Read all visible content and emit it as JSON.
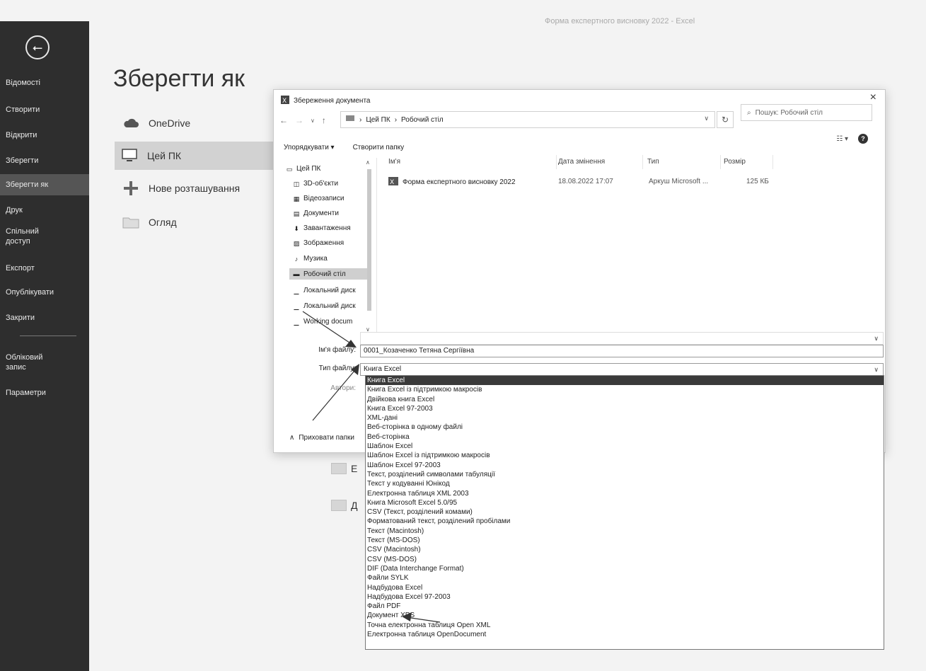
{
  "window_title": "Форма експертного висновку 2022 - Excel",
  "backstage": {
    "back_label": "⭠",
    "items": [
      {
        "label": "Відомості"
      },
      {
        "label": "Створити"
      },
      {
        "label": "Відкрити"
      },
      {
        "label": "Зберегти"
      },
      {
        "label": "Зберегти як"
      },
      {
        "label": "Друк"
      },
      {
        "label": "Спільний доступ"
      },
      {
        "label": "Експорт"
      },
      {
        "label": "Опублікувати"
      },
      {
        "label": "Закрити"
      },
      {
        "label": "Обліковий запис"
      },
      {
        "label": "Параметри"
      }
    ]
  },
  "page_title": "Зберегти як",
  "locations": [
    {
      "label": "OneDrive",
      "icon": "cloud-icon"
    },
    {
      "label": "Цей ПК",
      "icon": "computer-icon"
    },
    {
      "label": "Нове розташування",
      "icon": "plus-icon"
    },
    {
      "label": "Огляд",
      "icon": "folder-icon"
    }
  ],
  "recent_folders": [
    {
      "label": "E"
    },
    {
      "label": "Д"
    }
  ],
  "dialog": {
    "title": "Збереження документа",
    "close": "×",
    "path": [
      "Цей ПК",
      "Робочий стіл"
    ],
    "search_placeholder": "Пошук: Робочий стіл",
    "toolbar": {
      "organize": "Упорядкувати ▾",
      "new_folder": "Створити папку"
    },
    "tree": [
      {
        "label": "Цей ПК"
      },
      {
        "label": "3D-об'єкти"
      },
      {
        "label": "Відеозаписи"
      },
      {
        "label": "Документи"
      },
      {
        "label": "Завантаження"
      },
      {
        "label": "Зображення"
      },
      {
        "label": "Музика"
      },
      {
        "label": "Робочий стіл"
      },
      {
        "label": "Локальний диск"
      },
      {
        "label": "Локальний диск"
      },
      {
        "label": "Working docum"
      }
    ],
    "columns": {
      "name": "Ім'я",
      "date": "Дата змінення",
      "type": "Тип",
      "size": "Розмір"
    },
    "files": [
      {
        "name": "Форма експертного висновку 2022",
        "date": "18.08.2022 17:07",
        "type": "Аркуш Microsoft ...",
        "size": "125 КБ"
      }
    ],
    "filename_label": "Ім'я файлу:",
    "filename_value": "0001_Козаченко Тетяна Сергіївна",
    "filetype_label": "Тип файлу:",
    "filetype_value": "Книга Excel",
    "authors_label": "Автори:",
    "hide_folders": "Приховати папки"
  },
  "filetype_options": [
    "Книга Excel",
    "Книга Excel із підтримкою макросів",
    "Двійкова книга Excel",
    "Книга Excel 97-2003",
    "XML-дані",
    "Веб-сторінка в одному файлі",
    "Веб-сторінка",
    "Шаблон Excel",
    "Шаблон Excel із підтримкою макросів",
    "Шаблон Excel 97-2003",
    "Текст, розділений символами табуляції",
    "Текст у кодуванні Юнікод",
    "Електронна таблиця XML 2003",
    "Книга Microsoft Excel 5.0/95",
    "CSV (Текст, розділений комами)",
    "Форматований текст, розділений пробілами",
    "Текст (Macintosh)",
    "Текст (MS-DOS)",
    "CSV (Macintosh)",
    "CSV (MS-DOS)",
    "DIF (Data Interchange Format)",
    "Файли SYLK",
    "Надбудова Excel",
    "Надбудова Excel 97-2003",
    "Файл PDF",
    "Документ XPS",
    "Точна електронна таблиця Open XML",
    "Електронна таблиця OpenDocument"
  ],
  "selected_option_index": 0
}
